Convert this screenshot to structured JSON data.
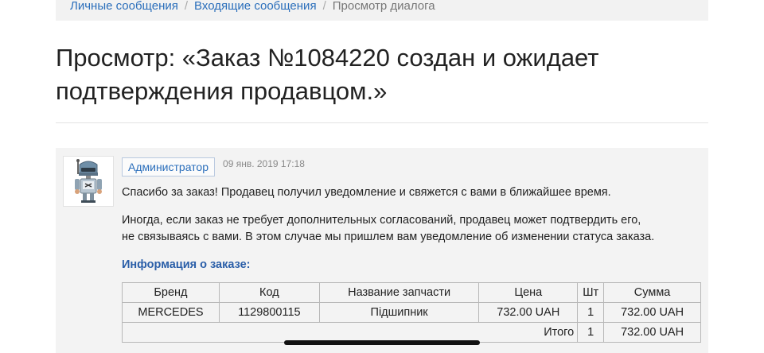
{
  "breadcrumb": {
    "items": [
      "Личные сообщения",
      "Входящие сообщения"
    ],
    "separator": "/",
    "current": "Просмотр диалога"
  },
  "page": {
    "title_line1": "Просмотр: «Заказ №1084220 создан и ожидает",
    "title_line2": "подтверждения продавцом.»"
  },
  "message": {
    "author": "Администратор",
    "date": "09 янв. 2019 17:18",
    "avatar_icon": "robot-avatar-icon",
    "paragraph1": "Спасибо за заказ! Продавец получил уведомление и свяжется с вами в ближайшее время.",
    "paragraph2_line1": "Иногда, если заказ не требует дополнительных согласований, продавец может подтвердить его,",
    "paragraph2_line2": "не связываясь с вами. В этом случае мы пришлем вам уведомление об изменении статуса заказа.",
    "info_heading": "Информация о заказе:"
  },
  "order_table": {
    "headers": [
      "Бренд",
      "Код",
      "Название запчасти",
      "Цена",
      "Шт",
      "Сумма"
    ],
    "rows": [
      [
        "MERCEDES",
        "1129800115",
        "Підшипник",
        "732.00 UAH",
        "1",
        "732.00 UAH"
      ]
    ],
    "total_label": "Итого",
    "total_qty": "1",
    "total_sum": "732.00 UAH"
  },
  "colors": {
    "link": "#2a6ebb",
    "heading_blue": "#2a5ea8",
    "panel_bg": "#f3f3f3"
  }
}
